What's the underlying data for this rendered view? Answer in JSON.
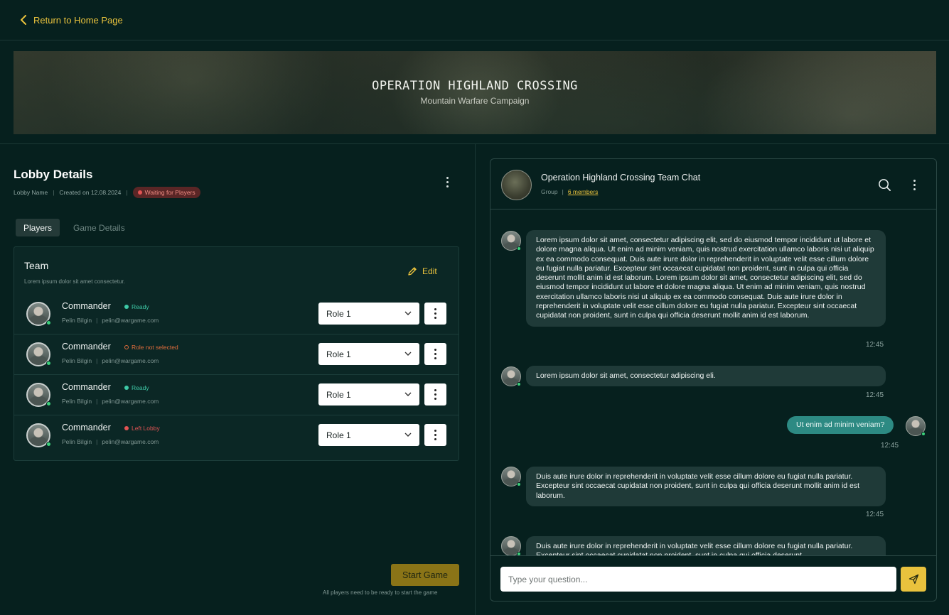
{
  "nav": {
    "back_label": "Return to Home Page"
  },
  "hero": {
    "title": "OPERATION HIGHLAND CROSSING",
    "subtitle": "Mountain Warfare Campaign"
  },
  "lobby": {
    "title": "Lobby Details",
    "name_label": "Lobby Name",
    "created": "Created on 12.08.2024",
    "status": "Waiting for Players"
  },
  "tabs": [
    {
      "label": "Players"
    },
    {
      "label": "Game Details"
    }
  ],
  "team": {
    "title": "Team",
    "description": "Lorem ipsum dolor sit amet consectetur.",
    "edit_label": "Edit",
    "players": [
      {
        "role_name": "Commander",
        "status": "Ready",
        "status_color": "#3ec9a7",
        "user": "Pelin Bilgin",
        "email": "pelin@wargame.com",
        "role": "Role 1"
      },
      {
        "role_name": "Commander",
        "status": "Role not selected",
        "status_color": "#e26d3c",
        "user": "Pelin Bilgin",
        "email": "pelin@wargame.com",
        "role": "Role 1"
      },
      {
        "role_name": "Commander",
        "status": "Ready",
        "status_color": "#3ec9a7",
        "user": "Pelin Bilgin",
        "email": "pelin@wargame.com",
        "role": "Role 1"
      },
      {
        "role_name": "Commander",
        "status": "Left Lobby",
        "status_color": "#e35454",
        "user": "Pelin Bilgin",
        "email": "pelin@wargame.com",
        "role": "Role 1"
      }
    ]
  },
  "actions": {
    "start_label": "Start Game",
    "start_hint": "All players need to be ready to start the game"
  },
  "chat": {
    "title": "Operation Highland Crossing Team Chat",
    "type": "Group",
    "members": "6 members",
    "messages": [
      {
        "text": "Lorem ipsum dolor sit amet, consectetur adipiscing elit, sed do eiusmod tempor incididunt ut labore et dolore magna aliqua. Ut enim ad minim veniam, quis nostrud exercitation ullamco laboris nisi ut aliquip ex ea commodo consequat. Duis aute irure dolor in reprehenderit in voluptate velit esse cillum dolore eu fugiat nulla pariatur. Excepteur sint occaecat cupidatat non proident, sunt in culpa qui officia deserunt mollit anim id est laborum. Lorem ipsum dolor sit amet, consectetur adipiscing elit, sed do eiusmod tempor incididunt ut labore et dolore magna aliqua. Ut enim ad minim veniam, quis nostrud exercitation ullamco laboris nisi ut aliquip ex ea commodo consequat. Duis aute irure dolor in reprehenderit in voluptate velit esse cillum dolore eu fugiat nulla pariatur. Excepteur sint occaecat cupidatat non proident, sunt in culpa qui officia deserunt mollit anim id est laborum.",
        "time": "12:45",
        "mine": false
      },
      {
        "text": "Lorem ipsum dolor sit amet, consectetur adipiscing eli.",
        "time": "12:45",
        "mine": false
      },
      {
        "text": "Ut enim ad minim veniam?",
        "time": "12:45",
        "mine": true
      },
      {
        "text": "Duis aute irure dolor in reprehenderit in voluptate velit esse cillum dolore eu fugiat nulla pariatur. Excepteur sint occaecat cupidatat non proident, sunt in culpa qui officia deserunt mollit anim id est laborum.",
        "time": "12:45",
        "mine": false
      },
      {
        "text": "Duis aute irure dolor in reprehenderit in voluptate velit esse cillum dolore eu fugiat nulla pariatur. Excepteur sint occaecat cupidatat non proident, sunt in culpa qui officia deserunt",
        "time": "",
        "mine": false
      }
    ],
    "input_placeholder": "Type your question..."
  },
  "colors": {
    "accent": "#e9c23d",
    "background": "#06201e",
    "online": "#3bd17b",
    "bubble_mine": "#2d8a83"
  }
}
